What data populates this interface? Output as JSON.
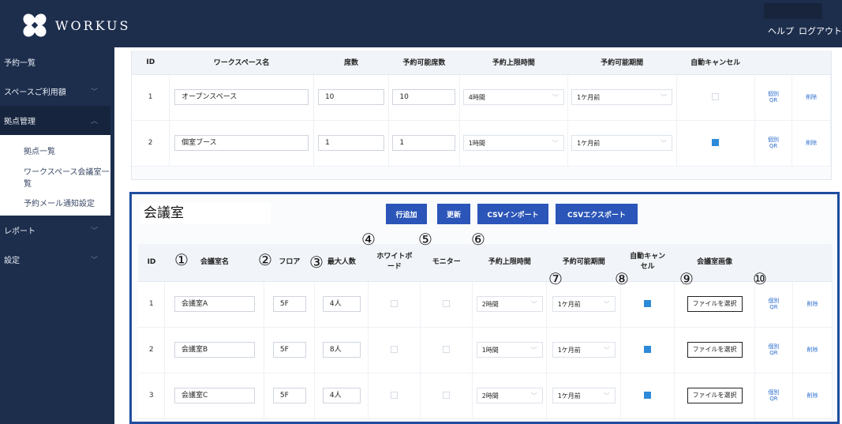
{
  "header": {
    "logo_text": "WORKUS",
    "links": [
      "ヘルプ",
      "ログアウト"
    ]
  },
  "sidebar": {
    "items": [
      {
        "label": "予約一覧",
        "chevron": false
      },
      {
        "label": "スペースご利用額",
        "chevron": true
      },
      {
        "label": "拠点管理",
        "chevron": true,
        "expanded": true
      }
    ],
    "sub_items": [
      "拠点一覧",
      "ワークスペース会議室一覧",
      "予約メール通知設定"
    ],
    "items_after": [
      {
        "label": "レポート",
        "chevron": true
      },
      {
        "label": "設定",
        "chevron": true
      }
    ]
  },
  "workspace_table": {
    "headers": [
      "ID",
      "ワークスペース名",
      "席数",
      "予約可能席数",
      "予約上限時間",
      "予約可能期間",
      "自動キャンセル",
      "",
      ""
    ],
    "rows": [
      {
        "id": "1",
        "name": "オープンスペース",
        "seats": "10",
        "bookable_seats": "10",
        "max_time": "4時間",
        "period": "1ケ月前",
        "auto_cancel": false,
        "qr": "個別QR",
        "delete": "削除"
      },
      {
        "id": "2",
        "name": "個室ブース",
        "seats": "1",
        "bookable_seats": "1",
        "max_time": "1時間",
        "period": "1ケ月前",
        "auto_cancel": true,
        "qr": "個別QR",
        "delete": "削除"
      }
    ]
  },
  "meeting_panel": {
    "title": "会議室",
    "buttons": [
      "行追加",
      "更新",
      "CSVインポート",
      "CSVエクスポート"
    ],
    "headers": [
      "ID",
      "会議室名",
      "フロア",
      "最大人数",
      "ホワイトボード",
      "モニター",
      "予約上限時間",
      "予約可能期間",
      "自動キャンセル",
      "会議室画像",
      "",
      ""
    ],
    "rows": [
      {
        "id": "1",
        "name": "会議室A",
        "floor": "5F",
        "capacity": "4人",
        "whiteboard": false,
        "monitor": false,
        "max_time": "2時間",
        "period": "1ケ月前",
        "auto_cancel": true,
        "file_button": "ファイルを選択",
        "qr": "個別QR",
        "delete": "削除"
      },
      {
        "id": "2",
        "name": "会議室B",
        "floor": "5F",
        "capacity": "8人",
        "whiteboard": false,
        "monitor": false,
        "max_time": "1時間",
        "period": "1ケ月前",
        "auto_cancel": true,
        "file_button": "ファイルを選択",
        "qr": "個別QR",
        "delete": "削除"
      },
      {
        "id": "3",
        "name": "会議室C",
        "floor": "5F",
        "capacity": "4人",
        "whiteboard": false,
        "monitor": false,
        "max_time": "2時間",
        "period": "1ケ月前",
        "auto_cancel": true,
        "file_button": "ファイルを選択",
        "qr": "個別QR",
        "delete": "削除"
      }
    ]
  },
  "annotations": [
    "①",
    "②",
    "③",
    "④",
    "⑤",
    "⑥",
    "⑦",
    "⑧",
    "⑨",
    "⑩"
  ],
  "colors": {
    "nav": "#1d2e4d",
    "button": "#2b55b8",
    "panel_border": "#1f4c9e",
    "checkbox_on": "#2d8ad8",
    "link": "#2d6fd0"
  }
}
